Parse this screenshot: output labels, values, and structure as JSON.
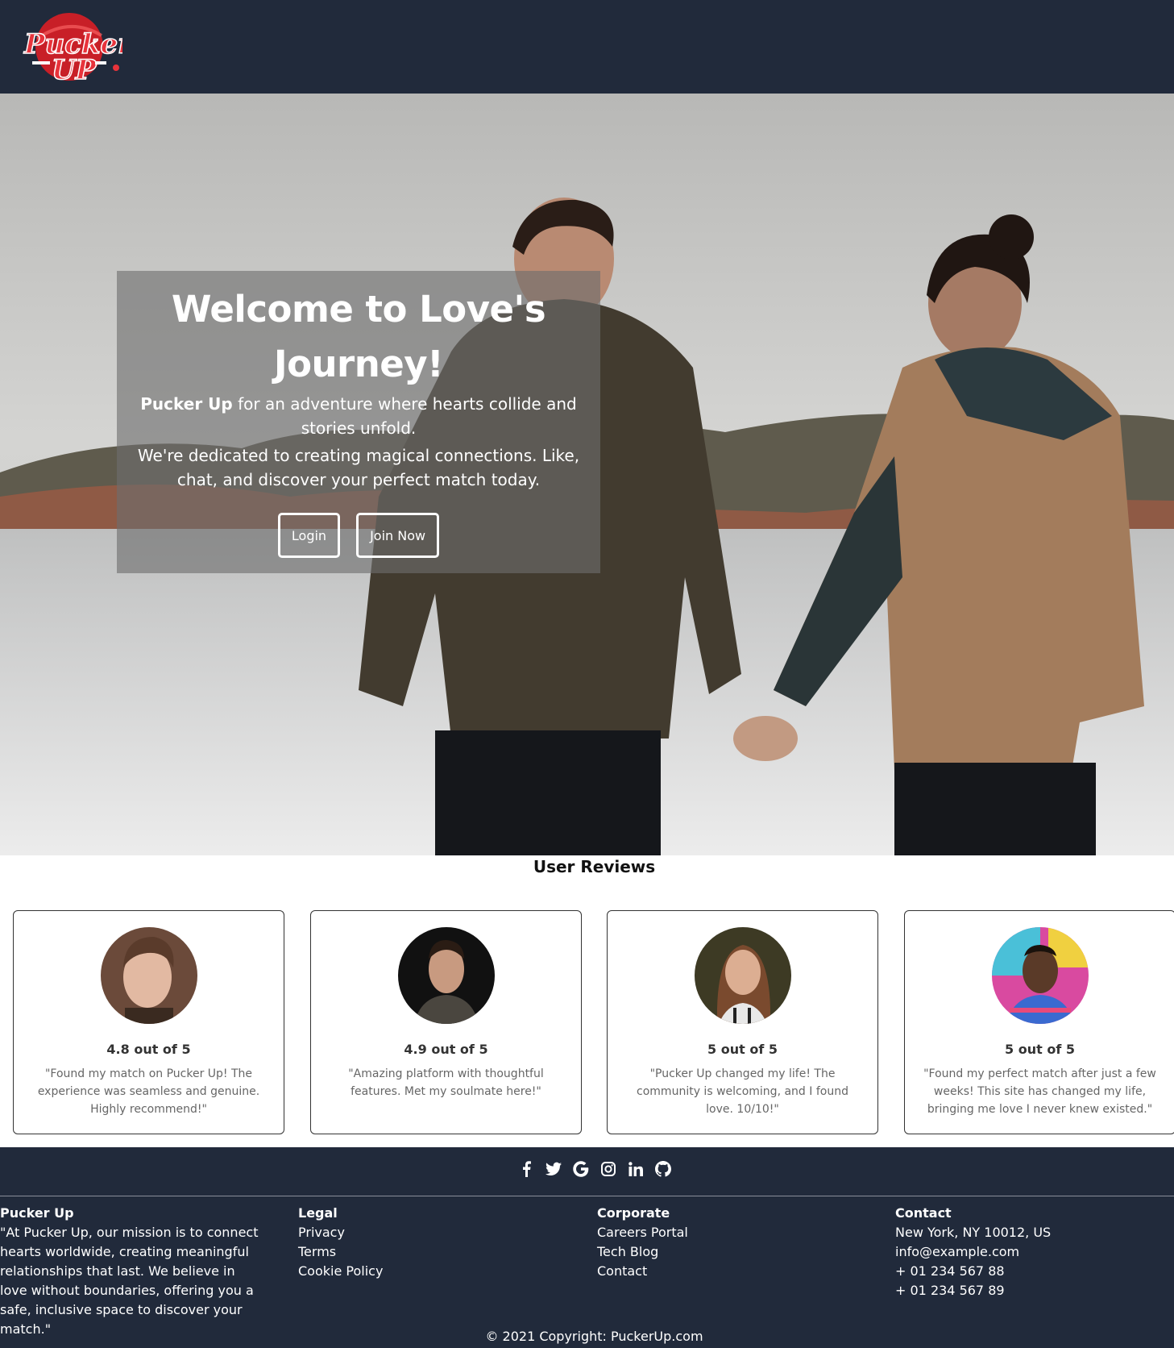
{
  "brand": {
    "logo_text_top": "Pucker",
    "logo_text_bottom": "UP"
  },
  "hero": {
    "title": "Welcome to Love's Journey!",
    "brand_strong": "Pucker Up",
    "line1_rest": " for an adventure where hearts collide and stories unfold.",
    "line2": "We're dedicated to creating magical connections. Like, chat, and discover your perfect match today.",
    "login_label": "Login",
    "join_label": "Join Now"
  },
  "reviews": {
    "title": "User Reviews",
    "items": [
      {
        "rating": "4.8 out of 5",
        "quote": "\"Found my match on Pucker Up! The experience was seamless and genuine. Highly recommend!\""
      },
      {
        "rating": "4.9 out of 5",
        "quote": "\"Amazing platform with thoughtful features. Met my soulmate here!\""
      },
      {
        "rating": "5 out of 5",
        "quote": "\"Pucker Up changed my life! The community is welcoming, and I found love. 10/10!\""
      },
      {
        "rating": "5 out of 5",
        "quote": "\"Found my perfect match after just a few weeks! This site has changed my life, bringing me love I never knew existed.\""
      }
    ]
  },
  "footer": {
    "social_icons": [
      "facebook-icon",
      "twitter-icon",
      "google-icon",
      "instagram-icon",
      "linkedin-icon",
      "github-icon"
    ],
    "about": {
      "heading": "Pucker Up",
      "text": "\"At Pucker Up, our mission is to connect hearts worldwide, creating meaningful relationships that last. We believe in love without boundaries, offering you a safe, inclusive space to discover your match.\""
    },
    "legal": {
      "heading": "Legal",
      "links": [
        "Privacy",
        "Terms",
        "Cookie Policy"
      ]
    },
    "corporate": {
      "heading": "Corporate",
      "links": [
        "Careers Portal",
        "Tech Blog",
        "Contact"
      ]
    },
    "contact": {
      "heading": "Contact",
      "lines": [
        "New York, NY 10012, US",
        "info@example.com",
        "+ 01 234 567 88",
        "+ 01 234 567 89"
      ]
    },
    "copyright": "© 2021 Copyright: PuckerUp.com"
  },
  "colors": {
    "nav_bg": "#212a3b",
    "logo_red": "#d7262e",
    "footer_bg": "#212a3b"
  }
}
